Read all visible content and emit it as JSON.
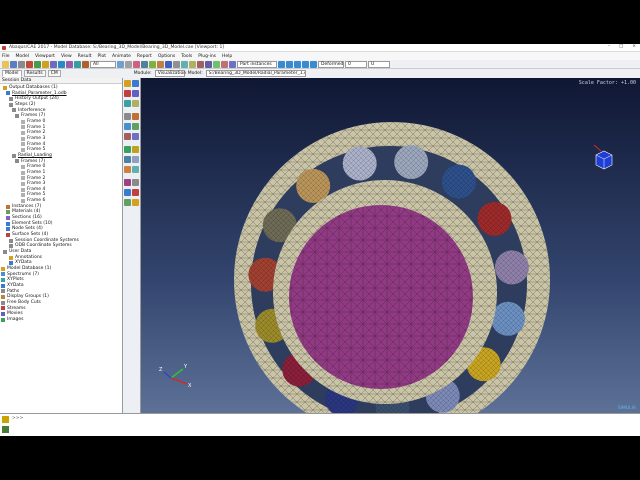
{
  "window": {
    "title": "Abaqus/CAE 2017 - Model Database: S:/Bearing_3D_Model/Bearing_3D_Model.cae [Viewport: 1]",
    "controls": [
      "–",
      "□",
      "×"
    ]
  },
  "menu": [
    "File",
    "Model",
    "Viewport",
    "View",
    "Result",
    "Plot",
    "Animate",
    "Report",
    "Options",
    "Tools",
    "Plug-ins",
    "Help"
  ],
  "toolbar": {
    "render_style": "All",
    "display_group": "Part instances",
    "deformed_select": "Deformed",
    "frame_value": "0",
    "odb_label": "U"
  },
  "tabs": {
    "model": "Model",
    "results": "Results",
    "cm": "CM",
    "module_label": "Module:",
    "module_value": "Visualization",
    "model_label": "Model:",
    "model_value": "S:/Bearing_3D_Model/Radial_Parameter_1.odb"
  },
  "tree_header": "Session Data",
  "tree": [
    "Output Databases (1)",
    "Radial_Parameter_1.odb",
    "History Output (24)",
    "Steps (2)",
    "Interference",
    "Frames (7)",
    "Frame 0",
    "Frame 1",
    "Frame 2",
    "Frame 3",
    "Frame 4",
    "Frame 5",
    "Radial_Loading",
    "Frames (7)",
    "Frame 0",
    "Frame 1",
    "Frame 2",
    "Frame 3",
    "Frame 4",
    "Frame 5",
    "Frame 6",
    "Instances (7)",
    "Materials (4)",
    "Sections (16)",
    "Element Sets (10)",
    "Node Sets (4)",
    "Surface Sets (4)",
    "Session Coordinate Systems",
    "ODB Coordinate Systems",
    "User Data",
    "Annotations",
    "XYData",
    "Model Database (1)",
    "Spectrums (7)",
    "XYPlots",
    "XYData",
    "Paths",
    "Display Groups (1)",
    "Free Body Cuts",
    "Streams",
    "Movies",
    "Images"
  ],
  "viewport": {
    "scale_label": "Scale Factor: +1.00",
    "logo": "SIMULIA",
    "axes": {
      "x": "X",
      "y": "Y",
      "z": "Z"
    },
    "colors": {
      "background_top": "#0f1733",
      "background_bottom": "#5d7197",
      "ring": "#c9c3a7",
      "hub": "#8f3a83",
      "balls": [
        "#9aa6bb",
        "#2d4f8a",
        "#9c2a2a",
        "#8e7fa8",
        "#6a8fc0",
        "#c7a322",
        "#7c88b6",
        "#3a4f6e",
        "#2a3680",
        "#8a1f3a",
        "#9a8a2a",
        "#a04030",
        "#6d6a55",
        "#b9945a",
        "#a9b0c8"
      ]
    }
  },
  "message_area": ">>>",
  "icons": [
    "abaqus-logo-icon",
    "file-open-icon",
    "save-icon",
    "print-icon",
    "zoom-icon",
    "rotate-icon",
    "pan-icon",
    "fit-icon",
    "contour-icon",
    "animate-icon",
    "query-icon",
    "tree-expand-icon"
  ]
}
